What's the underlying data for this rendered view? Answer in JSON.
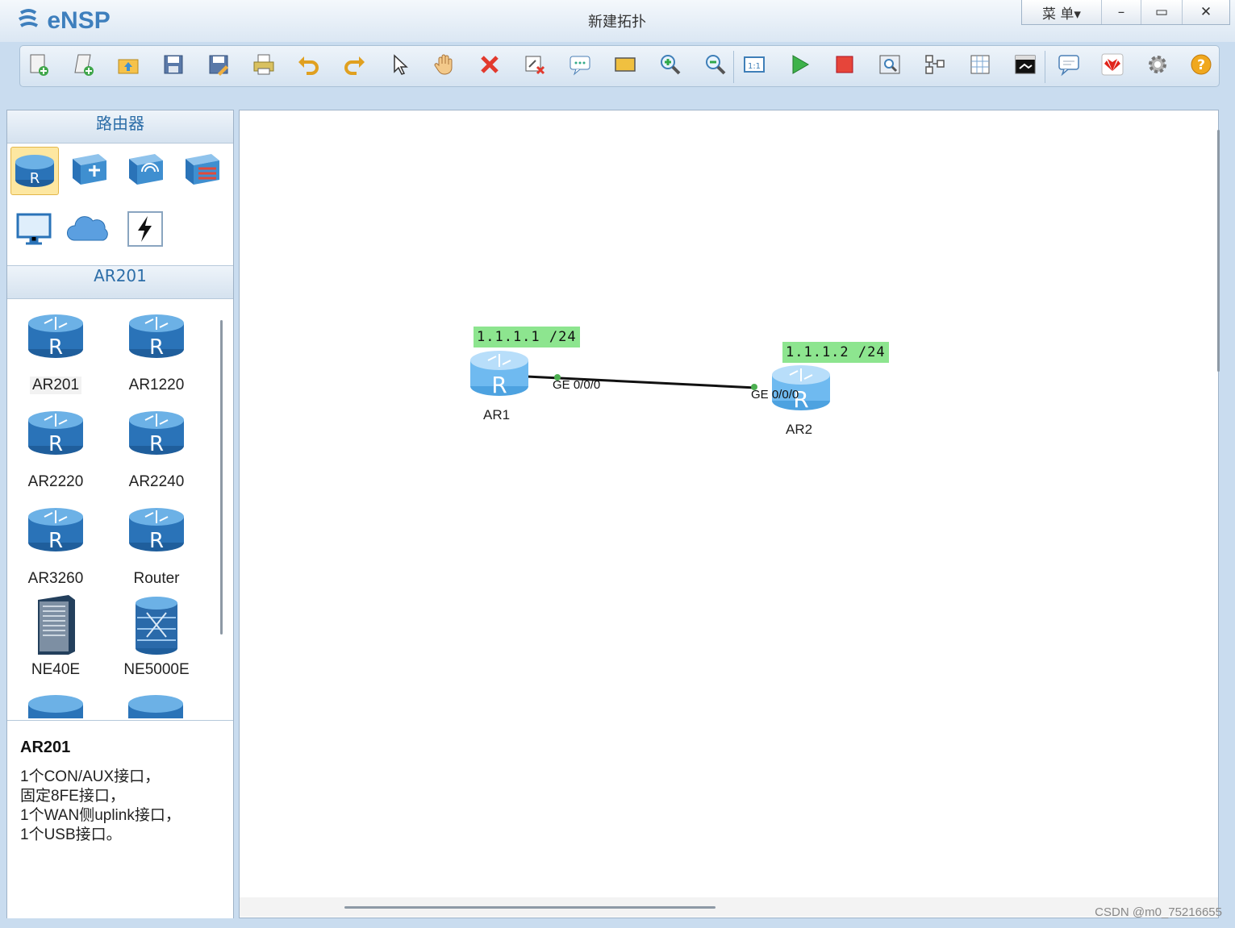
{
  "app": {
    "logo_text": "eNSP",
    "title": "新建拓扑"
  },
  "window_controls": {
    "menu": "菜 单▾",
    "minimize": "–",
    "maximize": "▭",
    "close": "✕"
  },
  "toolbar": [
    "new-topology-icon",
    "new-example-icon",
    "open-icon",
    "save-icon",
    "save-as-icon",
    "print-icon",
    "undo-icon",
    "redo-icon",
    "select-pointer-icon",
    "pan-hand-icon",
    "delete-icon",
    "delete-links-icon",
    "text-annotation-icon",
    "rectangle-icon",
    "zoom-in-icon",
    "zoom-out-icon",
    "fit-view-icon",
    "start-device-icon",
    "stop-device-icon",
    "capture-icon",
    "topology-icon",
    "grid-icon",
    "cli-terminal-icon",
    "chat-icon",
    "huawei-logo-icon",
    "settings-icon",
    "help-icon"
  ],
  "left_panel": {
    "category_title": "路由器",
    "categories": [
      "router-category-icon",
      "switch-category-icon",
      "wlan-category-icon",
      "firewall-category-icon",
      "pc-category-icon",
      "cloud-category-icon",
      "cable-category-icon"
    ],
    "model_title": "AR201",
    "devices": [
      {
        "label": "AR201",
        "icon": "router-icon"
      },
      {
        "label": "AR1220",
        "icon": "router-icon"
      },
      {
        "label": "AR2220",
        "icon": "router-icon"
      },
      {
        "label": "AR2240",
        "icon": "router-icon"
      },
      {
        "label": "AR3260",
        "icon": "router-icon"
      },
      {
        "label": "Router",
        "icon": "router-icon"
      },
      {
        "label": "NE40E",
        "icon": "chassis-icon"
      },
      {
        "label": "NE5000E",
        "icon": "stacked-router-icon"
      }
    ],
    "info": {
      "title": "AR201",
      "lines": [
        "1个CON/AUX接口，",
        "固定8FE接口，",
        "1个WAN侧uplink接口，",
        "1个USB接口。"
      ]
    }
  },
  "topology": {
    "nodes": [
      {
        "name": "AR1",
        "ip": "1.1.1.1 /24",
        "port": "GE 0/0/0"
      },
      {
        "name": "AR2",
        "ip": "1.1.1.2 /24",
        "port": "GE 0/0/0"
      }
    ]
  },
  "watermark": "CSDN @m0_75216655",
  "colors": {
    "ip_label_bg": "#8de58f",
    "accent": "#3e7fbd",
    "link_dot": "#4caf50"
  }
}
